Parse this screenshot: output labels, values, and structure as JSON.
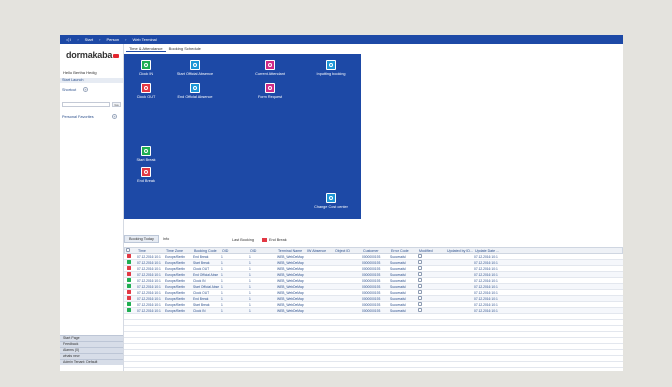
{
  "topbar": {
    "start_glyph": "◁ I",
    "crumbs": [
      "Start",
      "Person",
      "Web Terminal"
    ]
  },
  "sidebar": {
    "logo": "dormakaba",
    "user": "Hello Bertha Hedig",
    "sections": {
      "quick_launch": "Start Launch",
      "shortcut": "Shortcut",
      "personal_favorites": "Personal Favorites"
    },
    "go_label": "Go",
    "bottom_items": [
      "Start Page",
      "Feedback",
      "Alarms (0)",
      "whats new",
      "Admin Tenant: Default"
    ]
  },
  "tabs": [
    "Time & Attendance",
    "Booking Schedule"
  ],
  "tiles": [
    {
      "label": "Clock IN",
      "color": "g"
    },
    {
      "label": "Start Official Absence",
      "color": "c"
    },
    {
      "label": "Current Attendant",
      "color": "m"
    },
    {
      "label": "Inputting booking",
      "color": "c"
    },
    {
      "label": "Clock OUT",
      "color": "r"
    },
    {
      "label": "End Official Absence",
      "color": "c"
    },
    {
      "label": "Form Request",
      "color": "m"
    },
    {
      "label": "Start Break",
      "color": "g"
    },
    {
      "label": "End Break",
      "color": "r"
    },
    {
      "label": "Change Cost center",
      "color": "c"
    }
  ],
  "bottom_tabs": [
    "Booking Today",
    "Info"
  ],
  "last_booking": {
    "label": "Last Booking",
    "value": "End Break"
  },
  "table": {
    "headers": [
      "Time",
      "Time Zone",
      "Booking Code",
      "OID",
      "OID",
      "Terminal Name",
      "IW Absence",
      "Object ID",
      "Customer",
      "Error Code",
      "Modified",
      "Updated by ID...",
      "Update Date ..."
    ],
    "rows": [
      {
        "status": "red",
        "time": "07.12.2016 10:1",
        "tz": "Europe/Berlin",
        "code": "End Break",
        "oid": "1",
        "oid2": "1",
        "term": "WEB_WebDeMap",
        "cust": "0000000193",
        "err": "Successful",
        "upd": "07.12.2016 10:1"
      },
      {
        "status": "green",
        "time": "07.12.2016 10:1",
        "tz": "Europe/Berlin",
        "code": "Start Break",
        "oid": "1",
        "oid2": "1",
        "term": "WEB_WebDeMap",
        "cust": "0000000193",
        "err": "Successful",
        "upd": "07.12.2016 10:1"
      },
      {
        "status": "red",
        "time": "07.12.2016 10:1",
        "tz": "Europe/Berlin",
        "code": "Clock OUT",
        "oid": "1",
        "oid2": "1",
        "term": "WEB_WebDeMap",
        "cust": "0000000193",
        "err": "Successful",
        "upd": "07.12.2016 10:1"
      },
      {
        "status": "red",
        "time": "07.12.2016 10:1",
        "tz": "Europe/Berlin",
        "code": "End Official Abse",
        "oid": "1",
        "oid2": "1",
        "term": "WEB_WebDeMap",
        "cust": "0000000193",
        "err": "Successful",
        "upd": "07.12.2016 10:1"
      },
      {
        "status": "green",
        "time": "07.12.2016 10:1",
        "tz": "Europe/Berlin",
        "code": "Clock IN",
        "oid": "1",
        "oid2": "1",
        "term": "WEB_WebDeMap",
        "cust": "0000000193",
        "err": "Successful",
        "upd": "07.12.2016 10:1"
      },
      {
        "status": "green",
        "time": "07.12.2016 10:1",
        "tz": "Europe/Berlin",
        "code": "Start Official Abse",
        "oid": "1",
        "oid2": "1",
        "term": "WEB_WebDeMap",
        "cust": "0000000193",
        "err": "Successful",
        "upd": "07.12.2016 10:1"
      },
      {
        "status": "red",
        "time": "07.12.2016 10:1",
        "tz": "Europe/Berlin",
        "code": "Clock OUT",
        "oid": "1",
        "oid2": "1",
        "term": "WEB_WebDeMap",
        "cust": "0000000193",
        "err": "Successful",
        "upd": "07.12.2016 10:1"
      },
      {
        "status": "red",
        "time": "07.12.2016 10:1",
        "tz": "Europe/Berlin",
        "code": "End Break",
        "oid": "1",
        "oid2": "1",
        "term": "WEB_WebDeMap",
        "cust": "0000000193",
        "err": "Successful",
        "upd": "07.12.2016 10:1"
      },
      {
        "status": "green",
        "time": "07.12.2016 10:1",
        "tz": "Europe/Berlin",
        "code": "Start Break",
        "oid": "1",
        "oid2": "1",
        "term": "WEB_WebDeMap",
        "cust": "0000000193",
        "err": "Successful",
        "upd": "07.12.2016 10:1"
      },
      {
        "status": "green",
        "time": "07.12.2016 10:1",
        "tz": "Europe/Berlin",
        "code": "Clock IN",
        "oid": "1",
        "oid2": "1",
        "term": "WEB_WebDeMap",
        "cust": "0000000193",
        "err": "Successful",
        "upd": "07.12.2016 10:1"
      }
    ]
  }
}
